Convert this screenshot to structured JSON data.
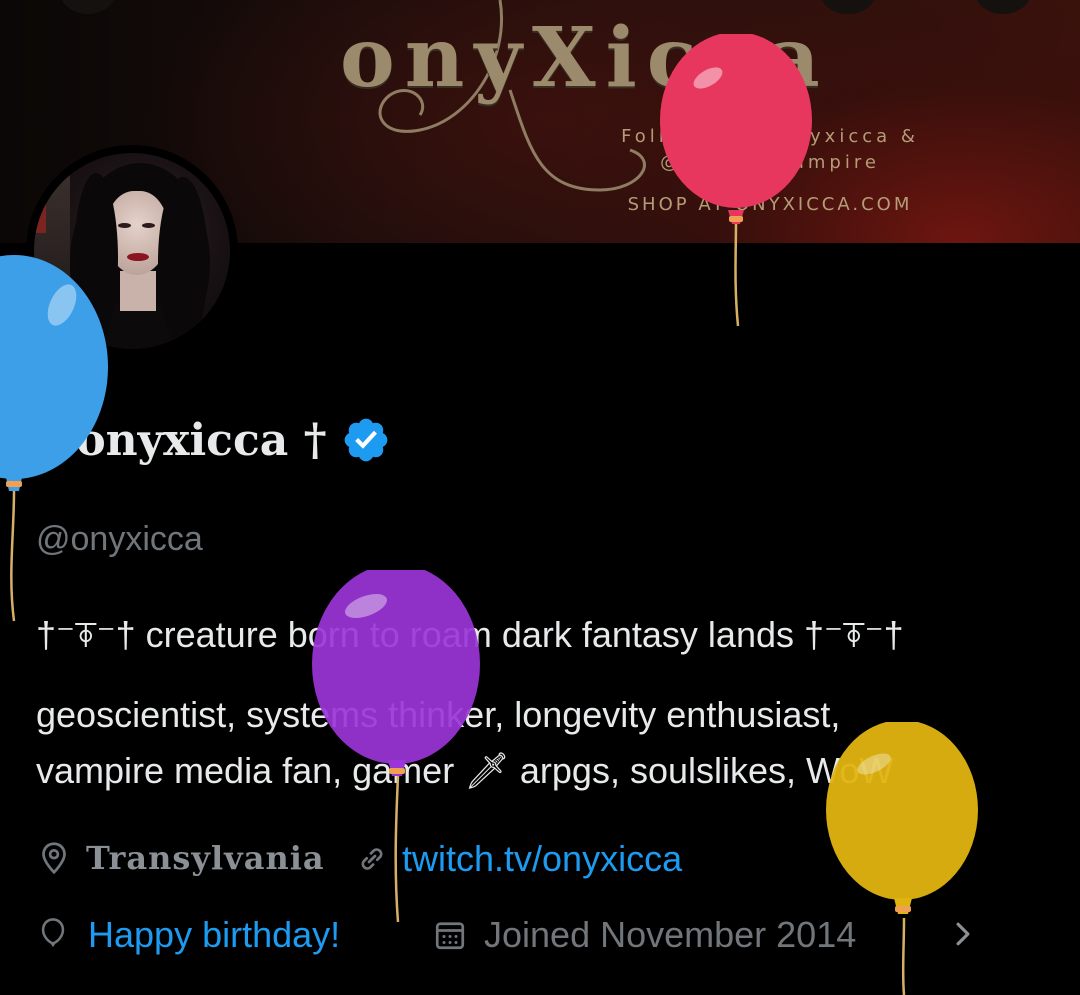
{
  "banner": {
    "logo_text": "onyXicca",
    "line1": "Follow me @onyxicca &",
    "line2": "@mindfulvampire",
    "line3": "SHOP AT ONYXICCA.COM"
  },
  "profile": {
    "display_name": "† onyxicca †",
    "handle": "@onyxicca",
    "bio_lines": [
      "†⁻⍕⁻† creature born to roam dark fantasy lands †⁻⍕⁻†",
      "geoscientist, systems thinker, longevity enthusiast,",
      "vampire media fan, gamer 🗡 arpgs, soulslikes, WoW"
    ],
    "location": "Transylvania",
    "website": "twitch.tv/onyxicca",
    "birthday": "Happy birthday!",
    "joined": "Joined November 2014"
  },
  "icons": {
    "verified": "verified-badge-icon",
    "location": "location-pin-icon",
    "link": "link-icon",
    "birthday": "balloon-icon",
    "calendar": "calendar-icon",
    "chevron": "chevron-right-icon"
  },
  "colors": {
    "background": "#000000",
    "text": "#e7e9ea",
    "muted": "#71767b",
    "link": "#1d9bf0",
    "balloon_red": "#e8375f",
    "balloon_blue": "#3d9fe8",
    "balloon_purple": "#9b35d8",
    "balloon_yellow": "#e0b410"
  }
}
